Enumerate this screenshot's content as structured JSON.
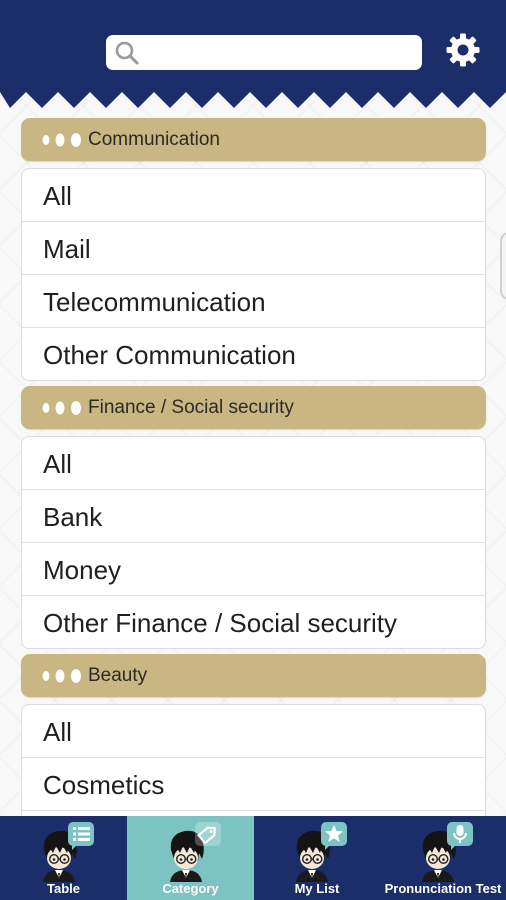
{
  "search": {
    "placeholder": "",
    "value": ""
  },
  "sections": [
    {
      "title": "Communication",
      "items": [
        "All",
        "Mail",
        "Telecommunication",
        "Other Communication"
      ]
    },
    {
      "title": "Finance / Social security",
      "items": [
        "All",
        "Bank",
        "Money",
        "Other Finance / Social security"
      ]
    },
    {
      "title": "Beauty",
      "items": [
        "All",
        "Cosmetics"
      ]
    }
  ],
  "tabs": [
    {
      "label": "Table",
      "icon": "list-icon",
      "active": false
    },
    {
      "label": "Category",
      "icon": "tag-icon",
      "active": true
    },
    {
      "label": "My List",
      "icon": "star-icon",
      "active": false
    },
    {
      "label": "Pronunciation Test",
      "icon": "microphone-icon",
      "active": false
    }
  ],
  "colors": {
    "header": "#1c2e6a",
    "section_header": "#c9b682",
    "active_tab": "#7dc3c4",
    "icon_badge": "#7dc3c4"
  }
}
